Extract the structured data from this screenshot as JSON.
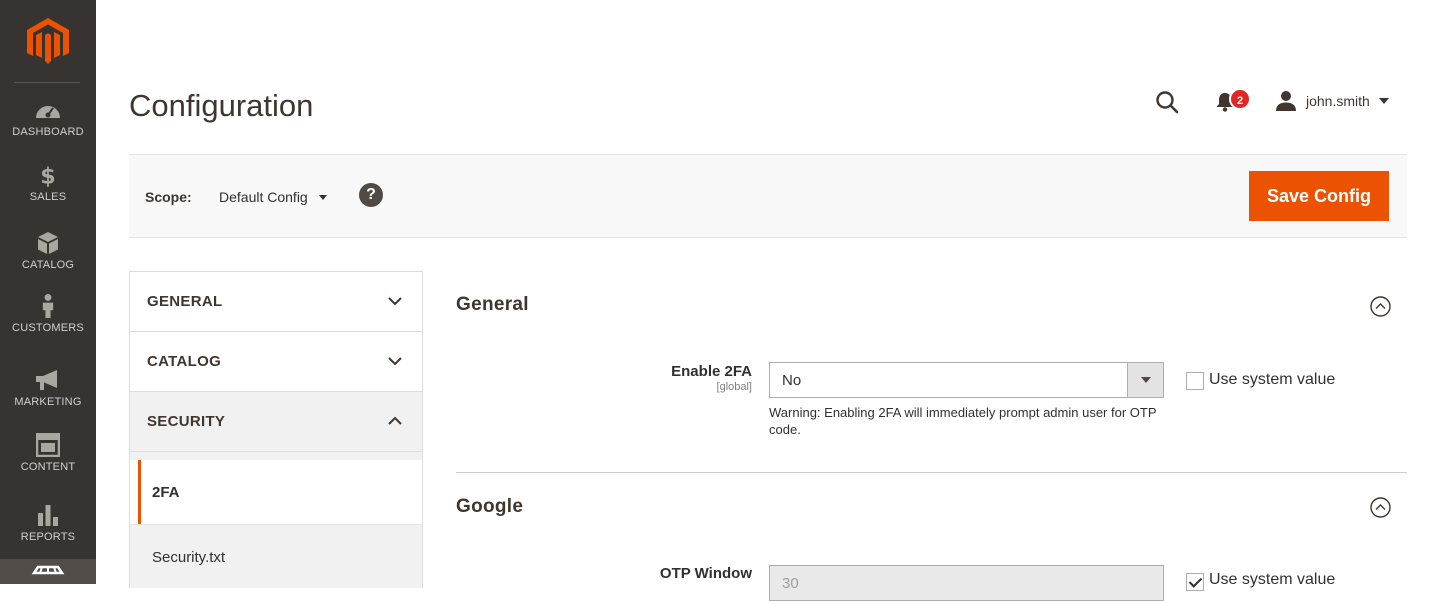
{
  "nav": {
    "items": [
      {
        "label": "DASHBOARD",
        "icon": "dashboard-icon"
      },
      {
        "label": "SALES",
        "icon": "dollar-icon"
      },
      {
        "label": "CATALOG",
        "icon": "box-icon"
      },
      {
        "label": "CUSTOMERS",
        "icon": "person-icon"
      },
      {
        "label": "MARKETING",
        "icon": "megaphone-icon"
      },
      {
        "label": "CONTENT",
        "icon": "layout-icon"
      },
      {
        "label": "REPORTS",
        "icon": "bar-chart-icon"
      }
    ],
    "brand_color": "#eb5202"
  },
  "header": {
    "title": "Configuration",
    "notifications_count": "2",
    "username": "john.smith"
  },
  "scope": {
    "label": "Scope:",
    "value": "Default Config",
    "help": "?",
    "save_label": "Save Config"
  },
  "tabs": {
    "general": "GENERAL",
    "catalog": "CATALOG",
    "security": "SECURITY",
    "sub": {
      "twofa": "2FA",
      "security_txt": "Security.txt"
    }
  },
  "sections": {
    "general": {
      "title": "General",
      "enable_2fa": {
        "label": "Enable 2FA",
        "scope": "[global]",
        "value": "No",
        "note": "Warning: Enabling 2FA will immediately prompt admin user for OTP code.",
        "use_system_label": "Use system value",
        "use_system_checked": false
      }
    },
    "google": {
      "title": "Google",
      "otp_window": {
        "label": "OTP Window",
        "value": "30",
        "use_system_label": "Use system value",
        "use_system_checked": true
      }
    }
  }
}
